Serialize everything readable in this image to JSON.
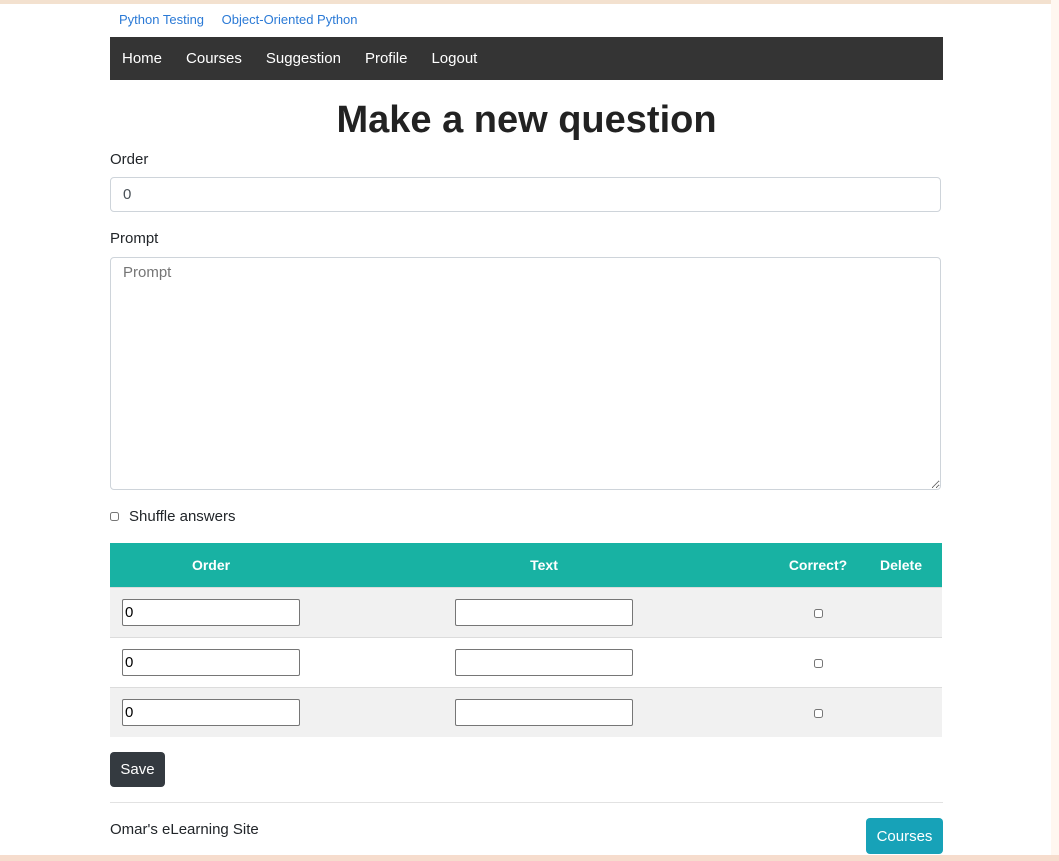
{
  "breadcrumbs": [
    "Python Testing",
    "Object-Oriented Python"
  ],
  "nav": {
    "items": [
      "Home",
      "Courses",
      "Suggestion",
      "Profile",
      "Logout"
    ]
  },
  "page": {
    "title": "Make a new question"
  },
  "form": {
    "order": {
      "label": "Order",
      "value": "0"
    },
    "prompt": {
      "label": "Prompt",
      "placeholder": "Prompt",
      "value": ""
    },
    "shuffle": {
      "label": "Shuffle answers",
      "checked": false
    }
  },
  "answers": {
    "headers": {
      "order": "Order",
      "text": "Text",
      "correct": "Correct?",
      "delete": "Delete"
    },
    "rows": [
      {
        "order": "0",
        "text": "",
        "correct": false
      },
      {
        "order": "0",
        "text": "",
        "correct": false
      },
      {
        "order": "0",
        "text": "",
        "correct": false
      }
    ]
  },
  "actions": {
    "save_label": "Save"
  },
  "footer": {
    "site_name": "Omar's eLearning Site",
    "courses_label": "Courses"
  },
  "colors": {
    "navbar": "#343434",
    "table_header": "#18b2a3",
    "save_button": "#343a40",
    "courses_button": "#17a2b8",
    "link": "#2b7ad6"
  }
}
